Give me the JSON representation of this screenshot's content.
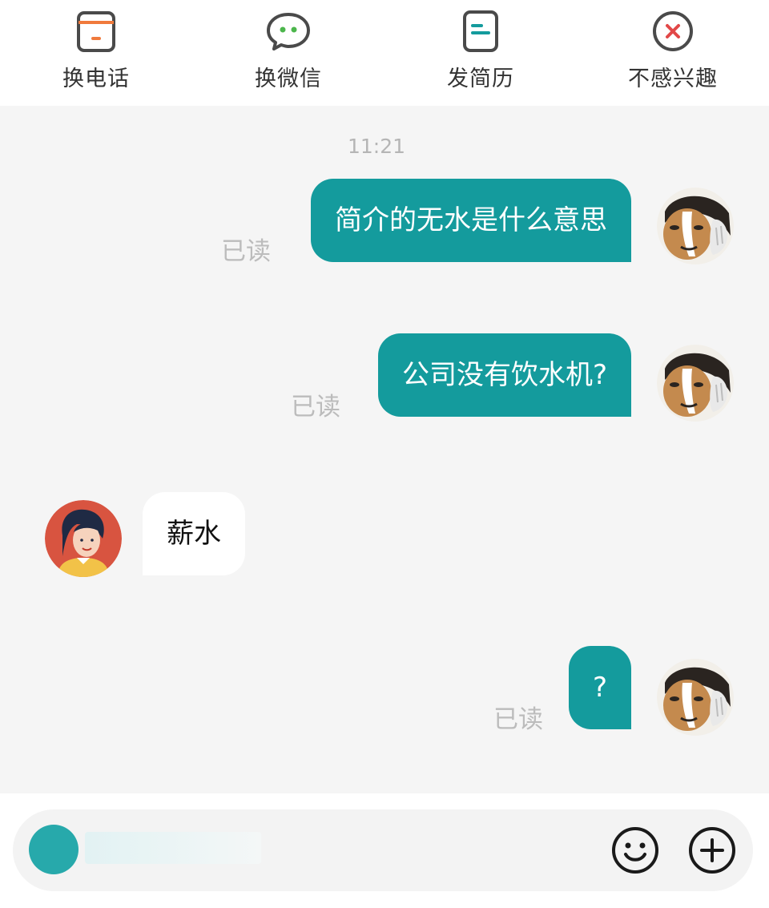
{
  "actions": [
    {
      "label": "换电话",
      "icon": "phone-card-icon"
    },
    {
      "label": "换微信",
      "icon": "wechat-icon"
    },
    {
      "label": "发简历",
      "icon": "resume-icon"
    },
    {
      "label": "不感兴趣",
      "icon": "not-interested-icon"
    }
  ],
  "chat": {
    "timestamp": "11:21",
    "messages": [
      {
        "direction": "out",
        "text": "简介的无水是什么意思",
        "status": "已读"
      },
      {
        "direction": "out",
        "text": "公司没有饮水机?",
        "status": "已读"
      },
      {
        "direction": "in",
        "text": "薪水"
      },
      {
        "direction": "out",
        "text": "?",
        "status": "已读"
      }
    ]
  },
  "input": {
    "value": ""
  },
  "colors": {
    "accent": "#149b9d",
    "orange": "#f07a3c",
    "green": "#4cb64c",
    "red": "#e24848",
    "background": "#f5f5f5"
  }
}
